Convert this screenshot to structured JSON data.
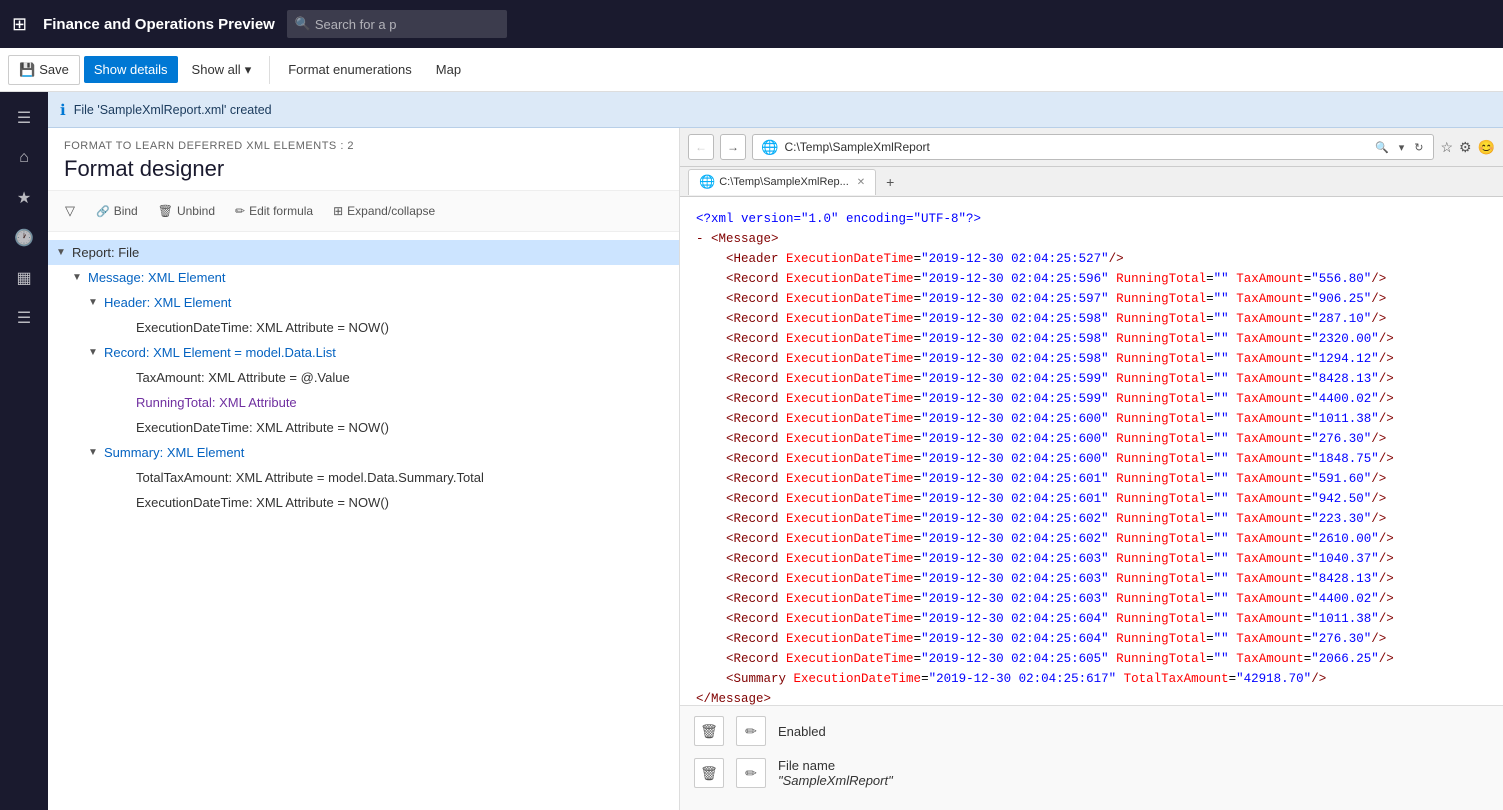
{
  "appBar": {
    "gridIcon": "⊞",
    "title": "Finance and Operations Preview",
    "searchPlaceholder": "Search for a p"
  },
  "toolbar": {
    "saveLabel": "Save",
    "showDetailsLabel": "Show details",
    "showAllLabel": "Show all",
    "formatEnumerationsLabel": "Format enumerations",
    "mapLabel": "Map"
  },
  "notification": {
    "icon": "ℹ",
    "message": "File 'SampleXmlReport.xml' created"
  },
  "leftPanel": {
    "subtitle": "FORMAT TO LEARN DEFERRED XML ELEMENTS : 2",
    "title": "Format designer",
    "filterIcon": "▽",
    "tools": [
      {
        "icon": "🔗",
        "label": "Bind"
      },
      {
        "icon": "🗑",
        "label": "Unbind"
      },
      {
        "icon": "✏",
        "label": "Edit formula"
      },
      {
        "icon": "⊞",
        "label": "Expand/collapse"
      }
    ],
    "tree": [
      {
        "level": 0,
        "arrow": "▼",
        "text": "Report: File",
        "color": "normal",
        "selected": true
      },
      {
        "level": 1,
        "arrow": "▼",
        "text": "Message: XML Element",
        "color": "blue"
      },
      {
        "level": 2,
        "arrow": "▼",
        "text": "Header: XML Element",
        "color": "blue"
      },
      {
        "level": 3,
        "arrow": "",
        "text": "ExecutionDateTime: XML Attribute = NOW()",
        "color": "normal"
      },
      {
        "level": 2,
        "arrow": "▼",
        "text": "Record: XML Element = model.Data.List",
        "color": "blue"
      },
      {
        "level": 3,
        "arrow": "",
        "text": "TaxAmount: XML Attribute = @.Value",
        "color": "normal"
      },
      {
        "level": 3,
        "arrow": "",
        "text": "RunningTotal: XML Attribute",
        "color": "purple"
      },
      {
        "level": 3,
        "arrow": "",
        "text": "ExecutionDateTime: XML Attribute = NOW()",
        "color": "normal"
      },
      {
        "level": 2,
        "arrow": "▼",
        "text": "Summary: XML Element",
        "color": "blue"
      },
      {
        "level": 3,
        "arrow": "",
        "text": "TotalTaxAmount: XML Attribute = model.Data.Summary.Total",
        "color": "normal"
      },
      {
        "level": 3,
        "arrow": "",
        "text": "ExecutionDateTime: XML Attribute = NOW()",
        "color": "normal"
      }
    ]
  },
  "browser": {
    "backDisabled": true,
    "forwardDisabled": false,
    "addressIcon": "🌐",
    "addressText": "C:\\Temp\\SampleXmlReport",
    "refreshIcon": "↻",
    "tab1Icon": "🌐",
    "tab1Text": "C:\\Temp\\SampleXmlRep...",
    "newTabIcon": "+"
  },
  "xml": {
    "declaration": "<?xml version=\"1.0\" encoding=\"UTF-8\"?>",
    "lines": [
      {
        "indent": 0,
        "content": "<Message>",
        "type": "open"
      },
      {
        "indent": 1,
        "content": "<Header ExecutionDateTime=",
        "attrName": "ExecutionDateTime",
        "attrVal": "\"2019-12-30 02:04:25:527\"",
        "selfClose": true
      },
      {
        "indent": 1,
        "raw": "<Record ExecutionDateTime=\"2019-12-30 02:04:25:596\" RunningTotal=\"\" TaxAmount=\"556.80\"/>",
        "type": "record"
      },
      {
        "indent": 1,
        "raw": "<Record ExecutionDateTime=\"2019-12-30 02:04:25:597\" RunningTotal=\"\" TaxAmount=\"906.25\"/>",
        "type": "record"
      },
      {
        "indent": 1,
        "raw": "<Record ExecutionDateTime=\"2019-12-30 02:04:25:598\" RunningTotal=\"\" TaxAmount=\"287.10\"/>",
        "type": "record"
      },
      {
        "indent": 1,
        "raw": "<Record ExecutionDateTime=\"2019-12-30 02:04:25:598\" RunningTotal=\"\" TaxAmount=\"2320.00\"/>",
        "type": "record"
      },
      {
        "indent": 1,
        "raw": "<Record ExecutionDateTime=\"2019-12-30 02:04:25:598\" RunningTotal=\"\" TaxAmount=\"1294.12\"/>",
        "type": "record"
      },
      {
        "indent": 1,
        "raw": "<Record ExecutionDateTime=\"2019-12-30 02:04:25:599\" RunningTotal=\"\" TaxAmount=\"8428.13\"/>",
        "type": "record"
      },
      {
        "indent": 1,
        "raw": "<Record ExecutionDateTime=\"2019-12-30 02:04:25:599\" RunningTotal=\"\" TaxAmount=\"4400.02\"/>",
        "type": "record"
      },
      {
        "indent": 1,
        "raw": "<Record ExecutionDateTime=\"2019-12-30 02:04:25:600\" RunningTotal=\"\" TaxAmount=\"1011.38\"/>",
        "type": "record"
      },
      {
        "indent": 1,
        "raw": "<Record ExecutionDateTime=\"2019-12-30 02:04:25:600\" RunningTotal=\"\" TaxAmount=\"276.30\"/>",
        "type": "record"
      },
      {
        "indent": 1,
        "raw": "<Record ExecutionDateTime=\"2019-12-30 02:04:25:600\" RunningTotal=\"\" TaxAmount=\"1848.75\"/>",
        "type": "record"
      },
      {
        "indent": 1,
        "raw": "<Record ExecutionDateTime=\"2019-12-30 02:04:25:601\" RunningTotal=\"\" TaxAmount=\"591.60\"/>",
        "type": "record"
      },
      {
        "indent": 1,
        "raw": "<Record ExecutionDateTime=\"2019-12-30 02:04:25:601\" RunningTotal=\"\" TaxAmount=\"942.50\"/>",
        "type": "record"
      },
      {
        "indent": 1,
        "raw": "<Record ExecutionDateTime=\"2019-12-30 02:04:25:602\" RunningTotal=\"\" TaxAmount=\"223.30\"/>",
        "type": "record"
      },
      {
        "indent": 1,
        "raw": "<Record ExecutionDateTime=\"2019-12-30 02:04:25:602\" RunningTotal=\"\" TaxAmount=\"2610.00\"/>",
        "type": "record"
      },
      {
        "indent": 1,
        "raw": "<Record ExecutionDateTime=\"2019-12-30 02:04:25:603\" RunningTotal=\"\" TaxAmount=\"1040.37\"/>",
        "type": "record"
      },
      {
        "indent": 1,
        "raw": "<Record ExecutionDateTime=\"2019-12-30 02:04:25:603\" RunningTotal=\"\" TaxAmount=\"8428.13\"/>",
        "type": "record"
      },
      {
        "indent": 1,
        "raw": "<Record ExecutionDateTime=\"2019-12-30 02:04:25:603\" RunningTotal=\"\" TaxAmount=\"4400.02\"/>",
        "type": "record"
      },
      {
        "indent": 1,
        "raw": "<Record ExecutionDateTime=\"2019-12-30 02:04:25:604\" RunningTotal=\"\" TaxAmount=\"1011.38\"/>",
        "type": "record"
      },
      {
        "indent": 1,
        "raw": "<Record ExecutionDateTime=\"2019-12-30 02:04:25:604\" RunningTotal=\"\" TaxAmount=\"276.30\"/>",
        "type": "record"
      },
      {
        "indent": 1,
        "raw": "<Record ExecutionDateTime=\"2019-12-30 02:04:25:605\" RunningTotal=\"\" TaxAmount=\"2066.25\"/>",
        "type": "record"
      },
      {
        "indent": 1,
        "raw": "<Summary ExecutionDateTime=\"2019-12-30 02:04:25:617\" TotalTaxAmount=\"42918.70\"/>",
        "type": "summary"
      },
      {
        "indent": 0,
        "content": "</Message>",
        "type": "close"
      }
    ]
  },
  "bottomFields": [
    {
      "label": "Enabled"
    },
    {
      "label": "File name",
      "value": "\"SampleXmlReport\""
    }
  ],
  "navIcons": [
    "≡",
    "⌂",
    "★",
    "🕐",
    "📋",
    "☰"
  ]
}
